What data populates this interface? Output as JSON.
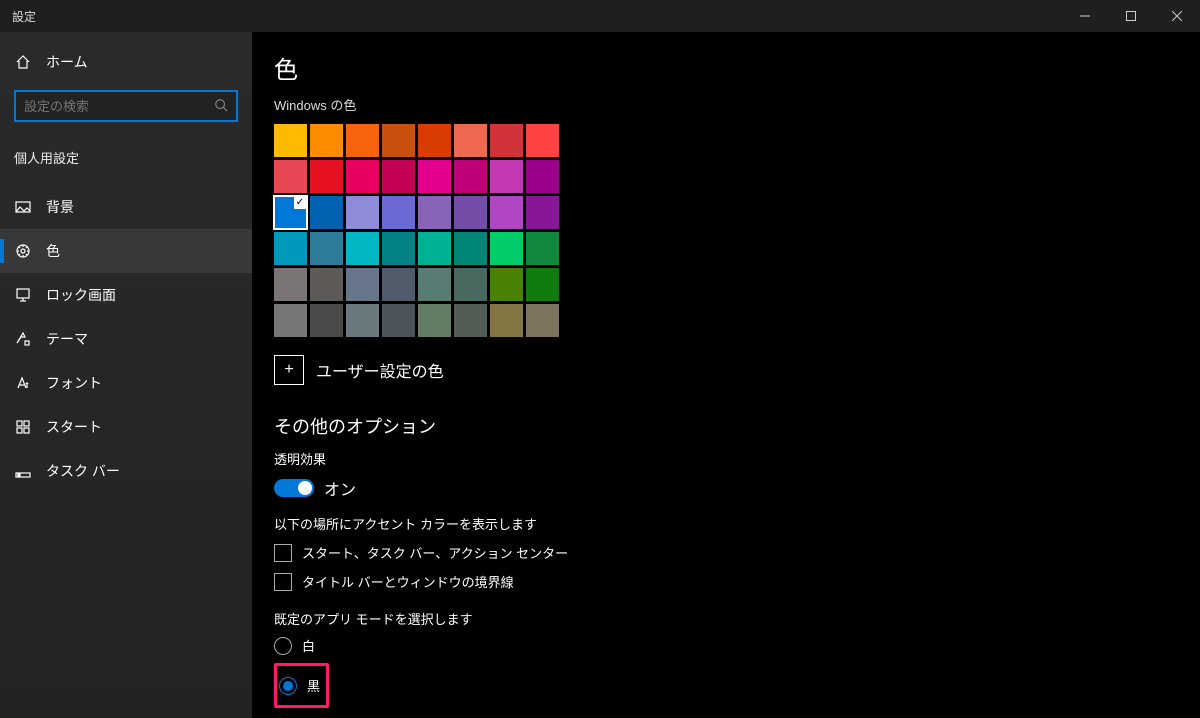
{
  "window": {
    "title": "設定"
  },
  "sidebar": {
    "home": "ホーム",
    "search_placeholder": "設定の検索",
    "category": "個人用設定",
    "items": [
      {
        "label": "背景"
      },
      {
        "label": "色",
        "active": true
      },
      {
        "label": "ロック画面"
      },
      {
        "label": "テーマ"
      },
      {
        "label": "フォント"
      },
      {
        "label": "スタート"
      },
      {
        "label": "タスク バー"
      }
    ]
  },
  "content": {
    "title": "色",
    "windows_colors_label": "Windows の色",
    "palette": [
      [
        "#ffb900",
        "#ff8c00",
        "#f7630c",
        "#ca5010",
        "#da3b01",
        "#ef6950",
        "#d13438",
        "#ff4343"
      ],
      [
        "#e74856",
        "#e81123",
        "#ea005e",
        "#c30052",
        "#e3008c",
        "#bf0077",
        "#c239b3",
        "#9a0089"
      ],
      [
        "#0078d7",
        "#0063b1",
        "#8e8cd8",
        "#6b69d6",
        "#8764b8",
        "#744da9",
        "#b146c2",
        "#881798"
      ],
      [
        "#0099bc",
        "#2d7d9a",
        "#00b7c3",
        "#038387",
        "#00b294",
        "#018574",
        "#00cc6a",
        "#10893e"
      ],
      [
        "#7a7574",
        "#5d5a58",
        "#68768a",
        "#515c6b",
        "#567c73",
        "#486860",
        "#498205",
        "#107c10"
      ],
      [
        "#767676",
        "#4c4a48",
        "#69797e",
        "#4a5459",
        "#647c64",
        "#525e54",
        "#847545",
        "#7e735f"
      ]
    ],
    "selected_swatch": {
      "row": 2,
      "col": 0
    },
    "custom_color_label": "ユーザー設定の色",
    "other_options_heading": "その他のオプション",
    "transparency": {
      "label": "透明効果",
      "state_label": "オン"
    },
    "show_accent_label": "以下の場所にアクセント カラーを表示します",
    "accent_checkboxes": [
      "スタート、タスク バー、アクション センター",
      "タイトル バーとウィンドウの境界線"
    ],
    "app_mode": {
      "label": "既定のアプリ モードを選択します",
      "options": [
        "白",
        "黒"
      ],
      "selected": 1
    }
  }
}
